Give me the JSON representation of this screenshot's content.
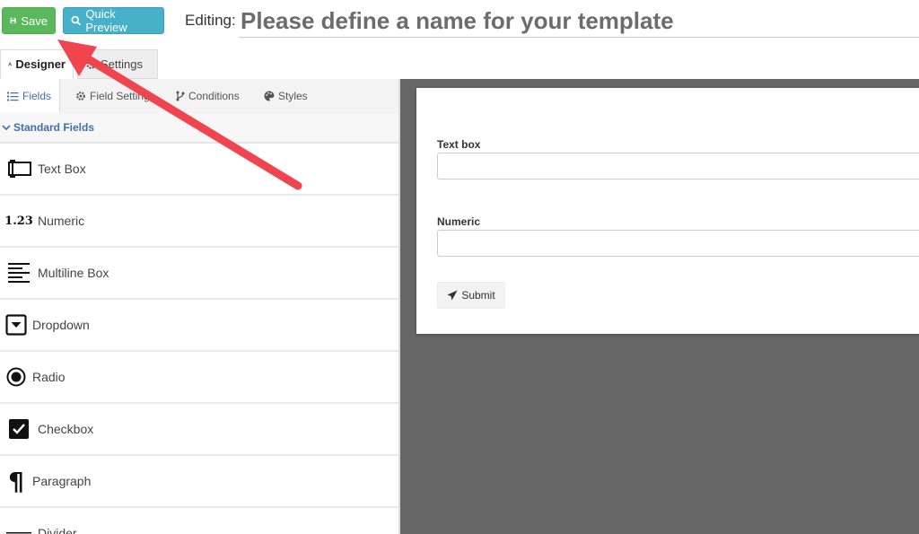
{
  "toolbar": {
    "save_label": "Save",
    "preview_label": "Quick Preview",
    "editing_label": "Editing:",
    "template_name_placeholder": "Please define a name for your template"
  },
  "main_tabs": [
    {
      "label": "Designer",
      "icon": "designer-icon",
      "active": true
    },
    {
      "label": "Settings",
      "icon": "gear-icon",
      "active": false
    }
  ],
  "sub_tabs": [
    {
      "label": "Fields",
      "icon": "list-icon",
      "active": true
    },
    {
      "label": "Field Settings",
      "icon": "gear-icon",
      "active": false
    },
    {
      "label": "Conditions",
      "icon": "branch-icon",
      "active": false
    },
    {
      "label": "Styles",
      "icon": "palette-icon",
      "active": false
    }
  ],
  "section": {
    "label": "Standard Fields",
    "icon": "chevron-down-icon"
  },
  "fields": [
    {
      "label": "Text Box",
      "icon": "textbox-icon"
    },
    {
      "label": "Numeric",
      "icon": "numeric-icon",
      "glyph": "1.23"
    },
    {
      "label": "Multiline Box",
      "icon": "multiline-icon"
    },
    {
      "label": "Dropdown",
      "icon": "dropdown-icon"
    },
    {
      "label": "Radio",
      "icon": "radio-icon"
    },
    {
      "label": "Checkbox",
      "icon": "checkbox-icon"
    },
    {
      "label": "Paragraph",
      "icon": "paragraph-icon",
      "glyph": "¶"
    },
    {
      "label": "Divider",
      "icon": "divider-icon"
    }
  ],
  "preview": {
    "fields": [
      {
        "label": "Text box",
        "value": ""
      },
      {
        "label": "Numeric",
        "value": ""
      }
    ],
    "submit_label": "Submit"
  },
  "colors": {
    "save": "#5cb85c",
    "preview": "#46b1c9",
    "accent": "#3f6fa8",
    "canvas": "#666666",
    "annotation_arrow": "#f0444f"
  }
}
